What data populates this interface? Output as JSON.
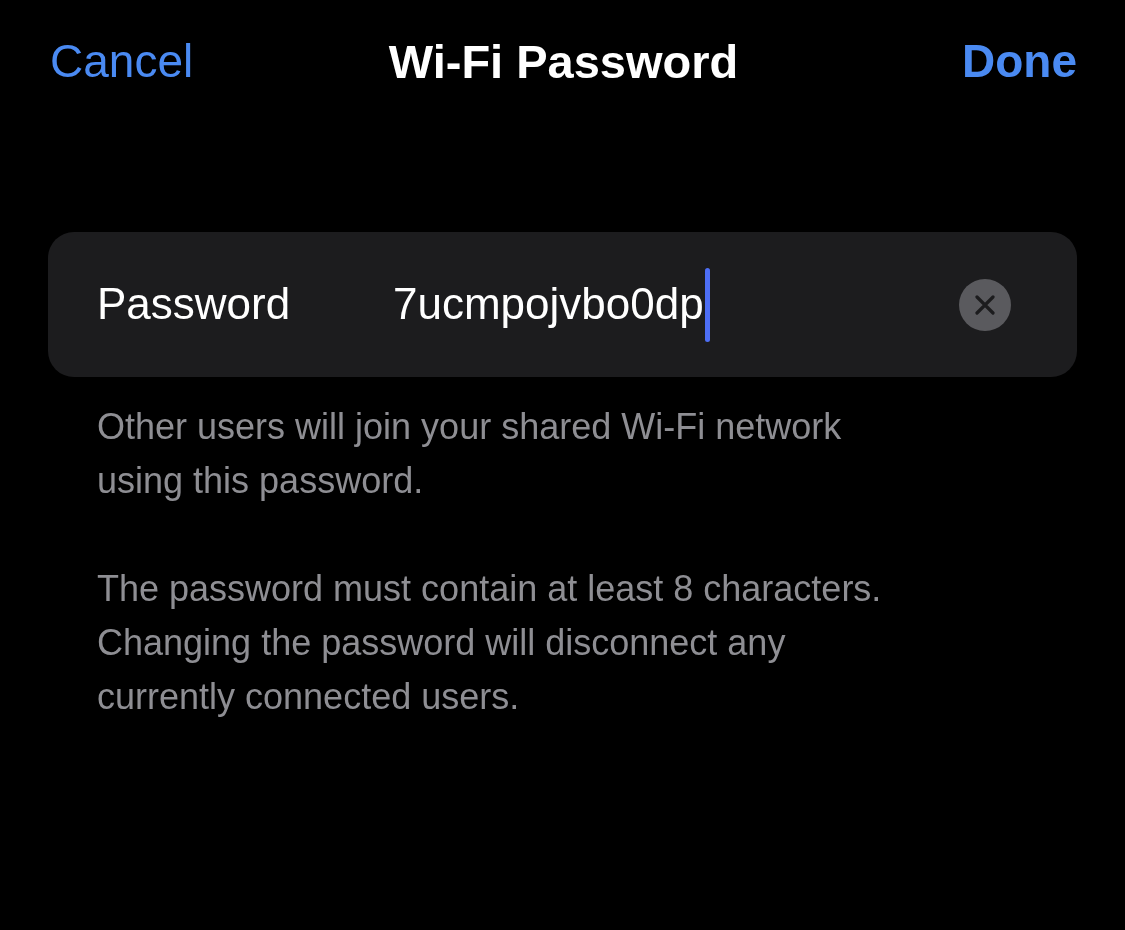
{
  "nav_bar": {
    "cancel": "Cancel",
    "title": "Wi-Fi Password",
    "done": "Done"
  },
  "password_row": {
    "label": "Password",
    "value": "7ucmpojvbo0dp",
    "focused": true
  },
  "footer_notes": [
    "Other users will join your shared Wi-Fi network using this password.",
    "The password must contain at least 8 characters. Changing the password will disconnect any currently connected users."
  ]
}
